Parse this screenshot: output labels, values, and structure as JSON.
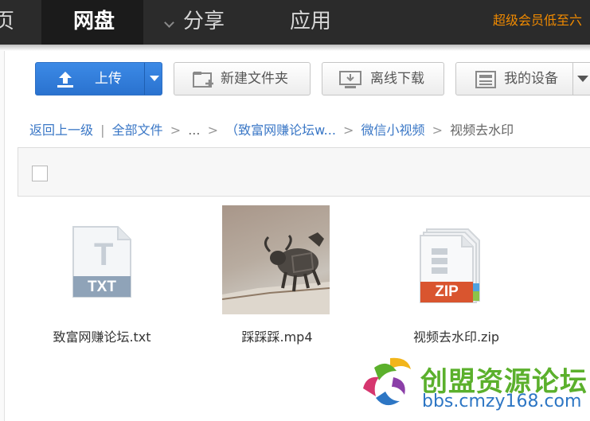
{
  "topnav": {
    "items": [
      "页",
      "网盘",
      "分享",
      "应用"
    ],
    "promo": "超级会员低至六"
  },
  "toolbar": {
    "upload_label": "上传",
    "new_folder_label": "新建文件夹",
    "offline_download_label": "离线下载",
    "my_devices_label": "我的设备"
  },
  "breadcrumb": {
    "back": "返回上一级",
    "separator_bar": "|",
    "all_files": "全部文件",
    "ellipsis": "...",
    "folder1": "（致富网赚论坛w...",
    "folder2": "微信小视频",
    "current": "视频去水印",
    "sep": ">"
  },
  "files": [
    {
      "name": "致富网赚论坛.txt",
      "type_label": "TXT",
      "glyph": "T"
    },
    {
      "name": "踩踩踩.mp4"
    },
    {
      "name": "视频去水印.zip",
      "type_label": "ZIP"
    }
  ],
  "watermark": {
    "title": "创盟资源论坛",
    "url": "bbs.cmzy168.com"
  },
  "colors": {
    "accent": "#3a77c6",
    "promo": "#f08a00",
    "nav_bg": "#2b2b2b"
  }
}
